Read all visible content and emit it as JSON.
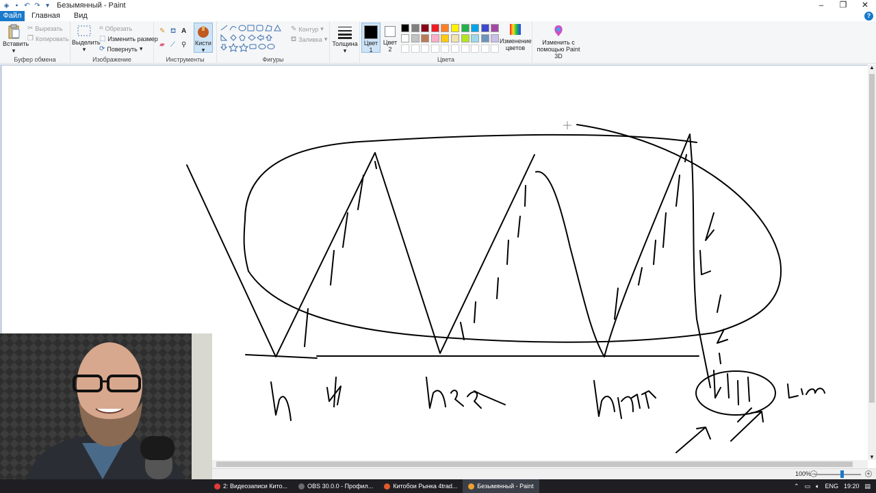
{
  "window": {
    "title": "Безымянный - Paint"
  },
  "menu": {
    "file": "Файл",
    "home": "Главная",
    "view": "Вид"
  },
  "ribbon": {
    "clipboard": {
      "label": "Буфер обмена",
      "paste": "Вставить",
      "cut": "Вырезать",
      "copy": "Копировать"
    },
    "image": {
      "label": "Изображение",
      "select": "Выделить",
      "crop": "Обрезать",
      "resize": "Изменить размер",
      "rotate": "Повернуть"
    },
    "tools": {
      "label": "Инструменты",
      "brushes": "Кисти"
    },
    "shapes": {
      "label": "Фигуры",
      "outline": "Контур",
      "fill": "Заливка"
    },
    "size": {
      "label": "Толщина"
    },
    "colors": {
      "label": "Цвета",
      "color1_a": "Цвет",
      "color1_b": "1",
      "color2_a": "Цвет",
      "color2_b": "2",
      "edit_a": "Изменение",
      "edit_b": "цветов",
      "color1_value": "#000000",
      "color2_value": "#ffffff",
      "palette_row1": [
        "#000000",
        "#7f7f7f",
        "#880015",
        "#ed1c24",
        "#ff7f27",
        "#fff200",
        "#22b14c",
        "#00a2e8",
        "#3f48cc",
        "#a349a4"
      ],
      "palette_row2": [
        "#ffffff",
        "#c3c3c3",
        "#b97a57",
        "#ffaec9",
        "#ffc90e",
        "#efe4b0",
        "#b5e61d",
        "#99d9ea",
        "#7092be",
        "#c8bfe7"
      ]
    },
    "paint3d": {
      "line1": "Изменить с",
      "line2": "помощью Paint 3D"
    }
  },
  "canvas": {
    "labels": {
      "label1": "h",
      "label2": "h",
      "label3": "h2",
      "label4": "hm",
      "label5": "Lim"
    }
  },
  "status": {
    "zoom": "100%"
  },
  "taskbar": {
    "tasks": [
      {
        "label": "2: Видеозаписи Кито...",
        "color": "#e33a3a",
        "active": false
      },
      {
        "label": "OBS 30.0.0 - Профил...",
        "color": "#6c6c6c",
        "active": false
      },
      {
        "label": "Китобои Рынка 4trad...",
        "color": "#e05a2b",
        "active": false
      },
      {
        "label": "Безымянный - Paint",
        "color": "#f0a030",
        "active": true
      }
    ],
    "lang": "ENG",
    "time": "19:20"
  }
}
